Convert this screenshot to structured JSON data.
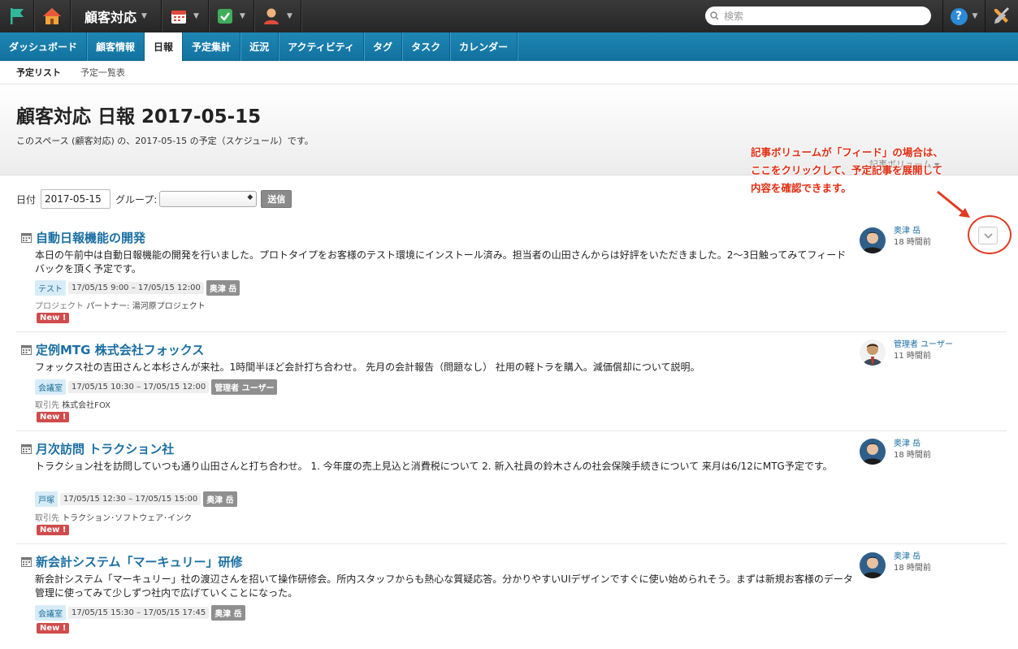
{
  "topbar": {
    "space_name": "顧客対応",
    "search_placeholder": "検索",
    "help_label": "?"
  },
  "nav": {
    "tabs": [
      {
        "label": "ダッシュボード",
        "active": false
      },
      {
        "label": "顧客情報",
        "active": false
      },
      {
        "label": "日報",
        "active": true
      },
      {
        "label": "予定集計",
        "active": false
      },
      {
        "label": "近況",
        "active": false
      },
      {
        "label": "アクティビティ",
        "active": false
      },
      {
        "label": "タグ",
        "active": false
      },
      {
        "label": "タスク",
        "active": false
      },
      {
        "label": "カレンダー",
        "active": false
      }
    ]
  },
  "subnav": {
    "items": [
      {
        "label": "予定リスト",
        "active": true
      },
      {
        "label": "予定一覧表",
        "active": false
      }
    ]
  },
  "header": {
    "title": "顧客対応 日報 2017-05-15",
    "description": "このスペース (顧客対応) の、2017-05-15 の予定（スケジュール）です。",
    "volume_label": "記事ボリューム"
  },
  "filter": {
    "date_label": "日付",
    "date_value": "2017-05-15",
    "group_label": "グループ:",
    "group_value": "",
    "submit_label": "送信"
  },
  "annotation": {
    "lines": [
      "記事ボリュームが「フィード」の場合は、",
      "ここをクリックして、予定記事を展開して",
      "内容を確認できます。"
    ]
  },
  "items": [
    {
      "title": "自動日報機能の開発",
      "body": "本日の午前中は自動日報機能の開発を行いました。プロトタイプをお客様のテスト環境にインストール済み。担当者の山田さんからは好評をいただきました。2〜3日触ってみてフィードバックを頂く予定です。",
      "tag": "テスト",
      "datetime": "17/05/15 9:00 – 17/05/15 12:00",
      "owner": "奥津 岳",
      "extra_key": "プロジェクト",
      "extra_value": "パートナー: 湯河原プロジェクト",
      "new_label": "New !",
      "author_name": "奥津 岳",
      "author_time": "18 時間前"
    },
    {
      "title": "定例MTG 株式会社フォックス",
      "body": "フォックス社の吉田さんと本杉さんが来社。1時間半ほど会計打ち合わせ。 先月の会計報告（問題なし） 社用の軽トラを購入。減価償却について説明。",
      "tag": "会議室",
      "datetime": "17/05/15 10:30 – 17/05/15 12:00",
      "owner": "管理者 ユーザー",
      "extra_key": "取引先",
      "extra_value": "株式会社FOX",
      "new_label": "New !",
      "author_name": "管理者 ユーザー",
      "author_time": "11 時間前"
    },
    {
      "title": "月次訪問 トラクション社",
      "body": "トラクション社を訪問していつも通り山田さんと打ち合わせ。 1. 今年度の売上見込と消費税について 2. 新入社員の鈴木さんの社会保険手続きについて 来月は6/12にMTG予定です。",
      "tag": "戸塚",
      "datetime": "17/05/15 12:30 – 17/05/15 15:00",
      "owner": "奥津 岳",
      "extra_key": "取引先",
      "extra_value": "トラクション･ソフトウェア･インク",
      "new_label": "New !",
      "author_name": "奥津 岳",
      "author_time": "18 時間前"
    },
    {
      "title": "新会計システム「マーキュリー」研修",
      "body": "新会計システム「マーキュリー」社の渡辺さんを招いて操作研修会。所内スタッフからも熱心な質疑応答。分かりやすいUIデザインですぐに使い始められそう。まずは新規お客様のデータ管理に使ってみて少しずつ社内で広げていくことになった。",
      "tag": "会議室",
      "datetime": "17/05/15 15:30 – 17/05/15 17:45",
      "owner": "奥津 岳",
      "extra_key": "",
      "extra_value": "",
      "new_label": "New !",
      "author_name": "奥津 岳",
      "author_time": "18 時間前"
    }
  ]
}
